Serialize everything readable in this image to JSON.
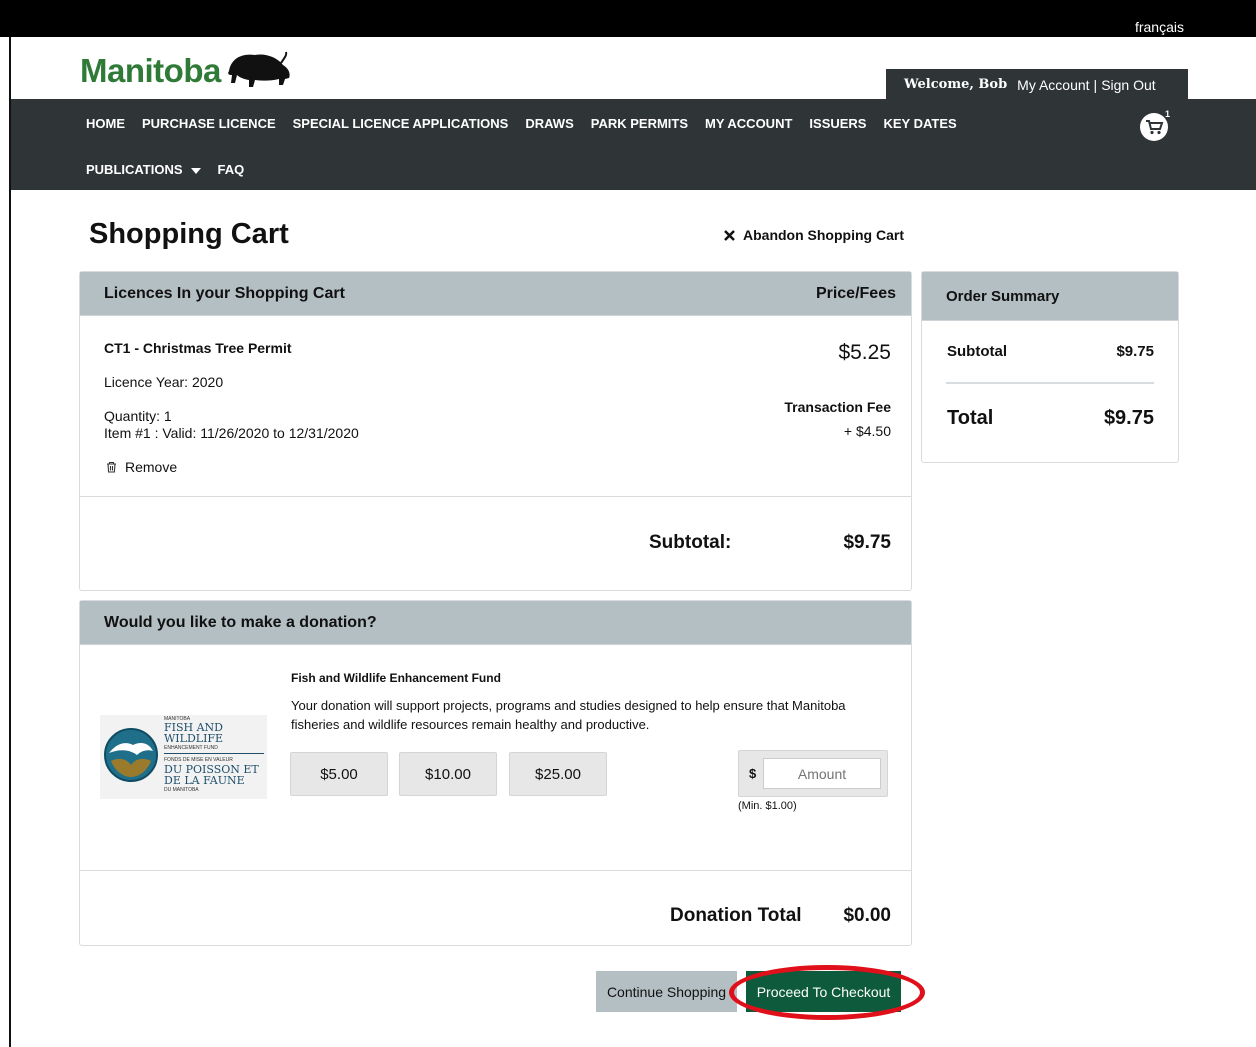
{
  "top_bar": {
    "language_link": "français"
  },
  "brand": {
    "logo_text": "Manitoba"
  },
  "user_bar": {
    "welcome": "Welcome, Bob",
    "my_account": "My Account",
    "separator": "|",
    "sign_out": "Sign Out"
  },
  "nav": {
    "row1": [
      "HOME",
      "PURCHASE LICENCE",
      "SPECIAL LICENCE APPLICATIONS",
      "DRAWS",
      "PARK PERMITS",
      "MY ACCOUNT",
      "ISSUERS",
      "KEY DATES"
    ],
    "publications": "PUBLICATIONS",
    "faq": "FAQ",
    "cart_count": "1"
  },
  "page": {
    "title": "Shopping Cart",
    "abandon_label": "Abandon Shopping Cart"
  },
  "cart": {
    "heading": "Licences In your Shopping Cart",
    "price_heading": "Price/Fees",
    "item": {
      "name": "CT1 - Christmas Tree Permit",
      "price": "$5.25",
      "licence_year": "Licence Year: 2020",
      "quantity": "Quantity: 1",
      "validity": "Item #1 : Valid: 11/26/2020 to 12/31/2020",
      "fee_label": "Transaction Fee",
      "fee_value": "+ $4.50",
      "remove": "Remove"
    },
    "subtotal_label": "Subtotal:",
    "subtotal_value": "$9.75"
  },
  "summary": {
    "heading": "Order Summary",
    "subtotal_label": "Subtotal",
    "subtotal_value": "$9.75",
    "total_label": "Total",
    "total_value": "$9.75"
  },
  "donation": {
    "heading": "Would you like to make a donation?",
    "fund_title": "Fish and Wildlife Enhancement Fund",
    "description": "Your donation will support projects, programs and studies designed to help ensure that Manitoba fisheries and wildlife resources remain healthy and productive.",
    "logo": {
      "line_small_top": "MANITOBA",
      "line1": "FISH AND",
      "line2": "WILDLIFE",
      "line_small_mid": "ENHANCEMENT FUND",
      "line_small_fr": "FONDS DE MISE EN VALEUR",
      "line3": "DU POISSON ET",
      "line4": "DE LA FAUNE",
      "line_small_bottom": "DU MANITOBA"
    },
    "amounts": [
      "$5.00",
      "$10.00",
      "$25.00"
    ],
    "currency_symbol": "$",
    "amount_placeholder": "Amount",
    "min_note": "(Min. $1.00)",
    "total_label": "Donation Total",
    "total_value": "$0.00"
  },
  "actions": {
    "continue": "Continue Shopping",
    "checkout": "Proceed To Checkout"
  },
  "colors": {
    "nav_bg": "#2f3437",
    "panel_head": "#b4bfc4",
    "brand_green": "#2f7a37",
    "checkout_bg": "#0e5a3d",
    "highlight": "#e0101a"
  }
}
